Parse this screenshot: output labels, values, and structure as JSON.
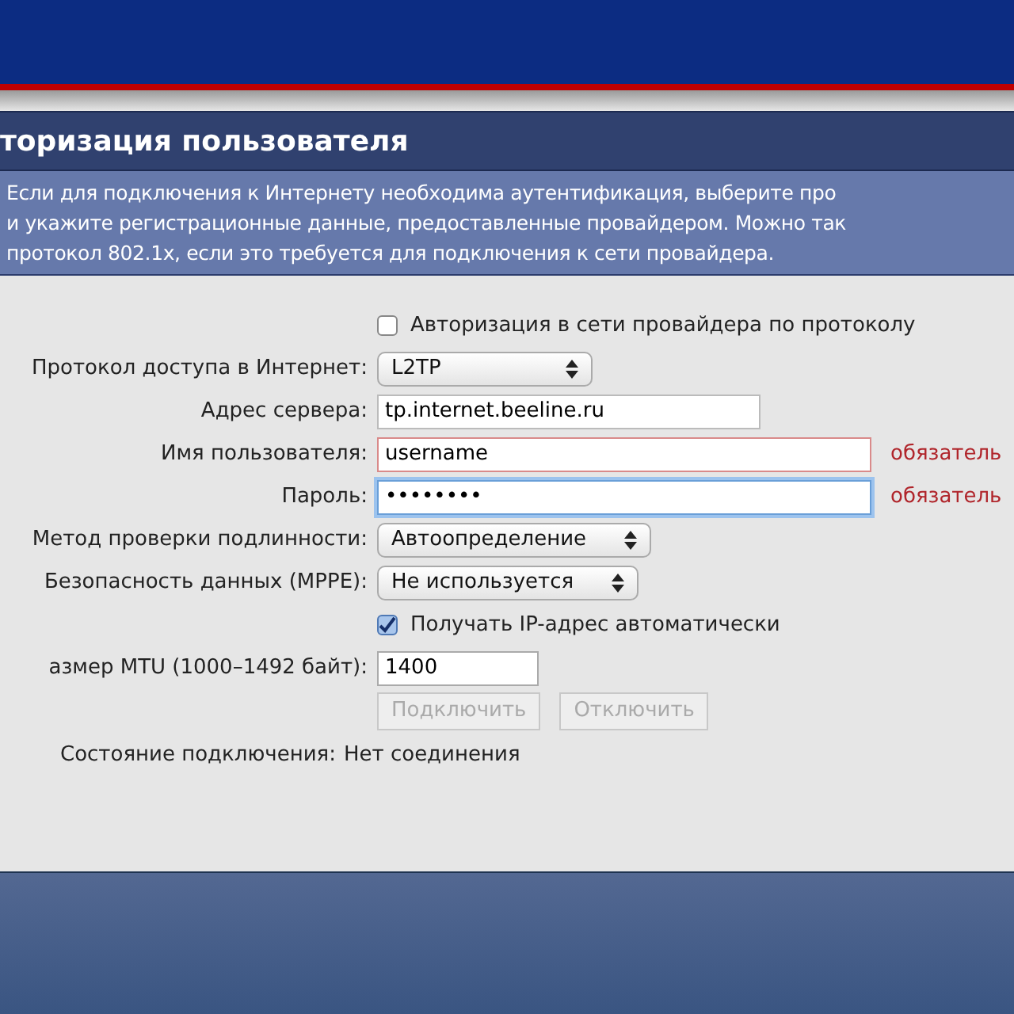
{
  "panel": {
    "title": "торизация пользователя",
    "description": [
      "Если для подключения к Интернету необходима аутентификация, выберите про",
      "и укажите регистрационные данные, предоставленные провайдером. Можно так",
      "протокол 802.1x, если это требуется для подключения к сети провайдера."
    ]
  },
  "form": [
    {
      "kind": "checkbox",
      "text": "Авторизация в сети провайдера по протоколу",
      "checked": false
    },
    {
      "kind": "select",
      "label": "Протокол доступа в Интернет:",
      "value": "L2TP"
    },
    {
      "kind": "input",
      "label": "Адрес сервера:",
      "value": "tp.internet.beeline.ru",
      "required": false,
      "focused": false
    },
    {
      "kind": "input",
      "label": "Имя пользователя:",
      "value": "username",
      "required": true,
      "note": "обязатель",
      "focused": false
    },
    {
      "kind": "password",
      "label": "Пароль:",
      "value": "••••••••",
      "required": true,
      "note": "обязатель",
      "focused": true
    },
    {
      "kind": "select",
      "label": "Метод проверки подлинности:",
      "value": "Автоопределение"
    },
    {
      "kind": "select",
      "label": "Безопасность данных (MPPE):",
      "value": "Не используется"
    },
    {
      "kind": "checkbox",
      "text": "Получать IP-адрес автоматически",
      "checked": true
    },
    {
      "kind": "mtu",
      "label": "азмер MTU (1000–1492 байт):",
      "value": "1400"
    },
    {
      "kind": "buttons",
      "buttons": [
        {
          "label": "Подключить",
          "disabled": true
        },
        {
          "label": "Отключить",
          "disabled": true
        }
      ]
    },
    {
      "kind": "status",
      "label": "Состояние подключения:",
      "value": "Нет соединения"
    }
  ]
}
